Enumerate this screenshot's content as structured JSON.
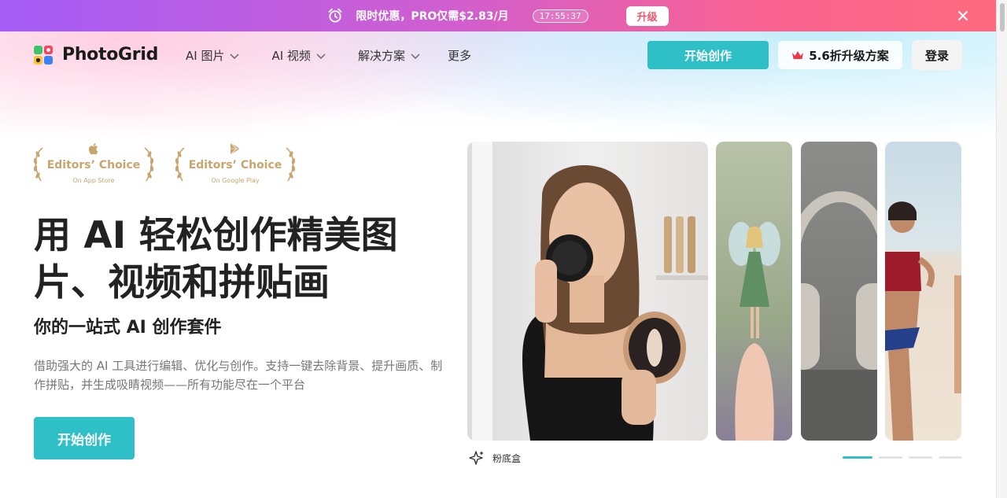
{
  "promo": {
    "text": "限时优惠，PRO仅需$2.83/月",
    "timer": "17:55:37",
    "button": "升级"
  },
  "header": {
    "logo_text": "PhotoGrid",
    "nav": [
      {
        "label": "AI 图片",
        "has_dropdown": true
      },
      {
        "label": "AI 视频",
        "has_dropdown": true
      },
      {
        "label": "解决方案",
        "has_dropdown": true
      },
      {
        "label": "更多",
        "has_dropdown": false
      }
    ],
    "create_button": "开始创作",
    "discount_button": "5.6折升级方案",
    "login_button": "登录"
  },
  "badges": [
    {
      "title": "Editors’ Choice",
      "subtitle": "On App Store",
      "icon": "apple-icon"
    },
    {
      "title": "Editors’ Choice",
      "subtitle": "On Google Play",
      "icon": "google-play-icon"
    }
  ],
  "hero": {
    "title": "用 AI 轻松创作精美图片、视频和拼贴画",
    "subtitle": "你的一站式 AI 创作套件",
    "description": "借助强大的 AI 工具进行编辑、优化与创作。支持一键去除背景、提升画质、制作拼贴，并生成吸睛视频——所有功能尽在一个平台",
    "cta": "开始创作"
  },
  "carousel": {
    "caption": "粉底盒",
    "slides": [
      "foundation-compact-photo",
      "fairy-on-finger-photo",
      "headphones-photo",
      "beach-runner-photo"
    ],
    "active_index": 0,
    "dot_count": 4
  },
  "colors": {
    "accent": "#2fbfc6",
    "promo_gradient_start": "#a35cf6",
    "promo_gradient_end": "#ff6a7f",
    "badge_gold": "#c9a56e"
  }
}
